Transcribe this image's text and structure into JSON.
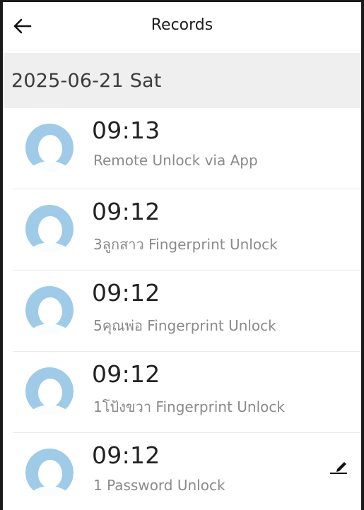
{
  "header": {
    "title": "Records",
    "back_icon": "arrow-left-icon"
  },
  "date_group": {
    "label": "2025-06-21 Sat"
  },
  "records": [
    {
      "time": "09:13",
      "description": "Remote Unlock via App"
    },
    {
      "time": "09:12",
      "description": "3ลูกสาว Fingerprint Unlock"
    },
    {
      "time": "09:12",
      "description": "5คุณพ่อ Fingerprint Unlock"
    },
    {
      "time": "09:12",
      "description": "1โป้งขวา Fingerprint Unlock"
    },
    {
      "time": "09:12",
      "description": "1 Password Unlock"
    }
  ],
  "icons": {
    "avatar": "user-avatar-icon",
    "edit": "pencil-edit-icon"
  },
  "colors": {
    "avatar_blue": "#9fcbe9",
    "date_bar_bg": "#efefef",
    "secondary_text": "#8a8a8a"
  }
}
